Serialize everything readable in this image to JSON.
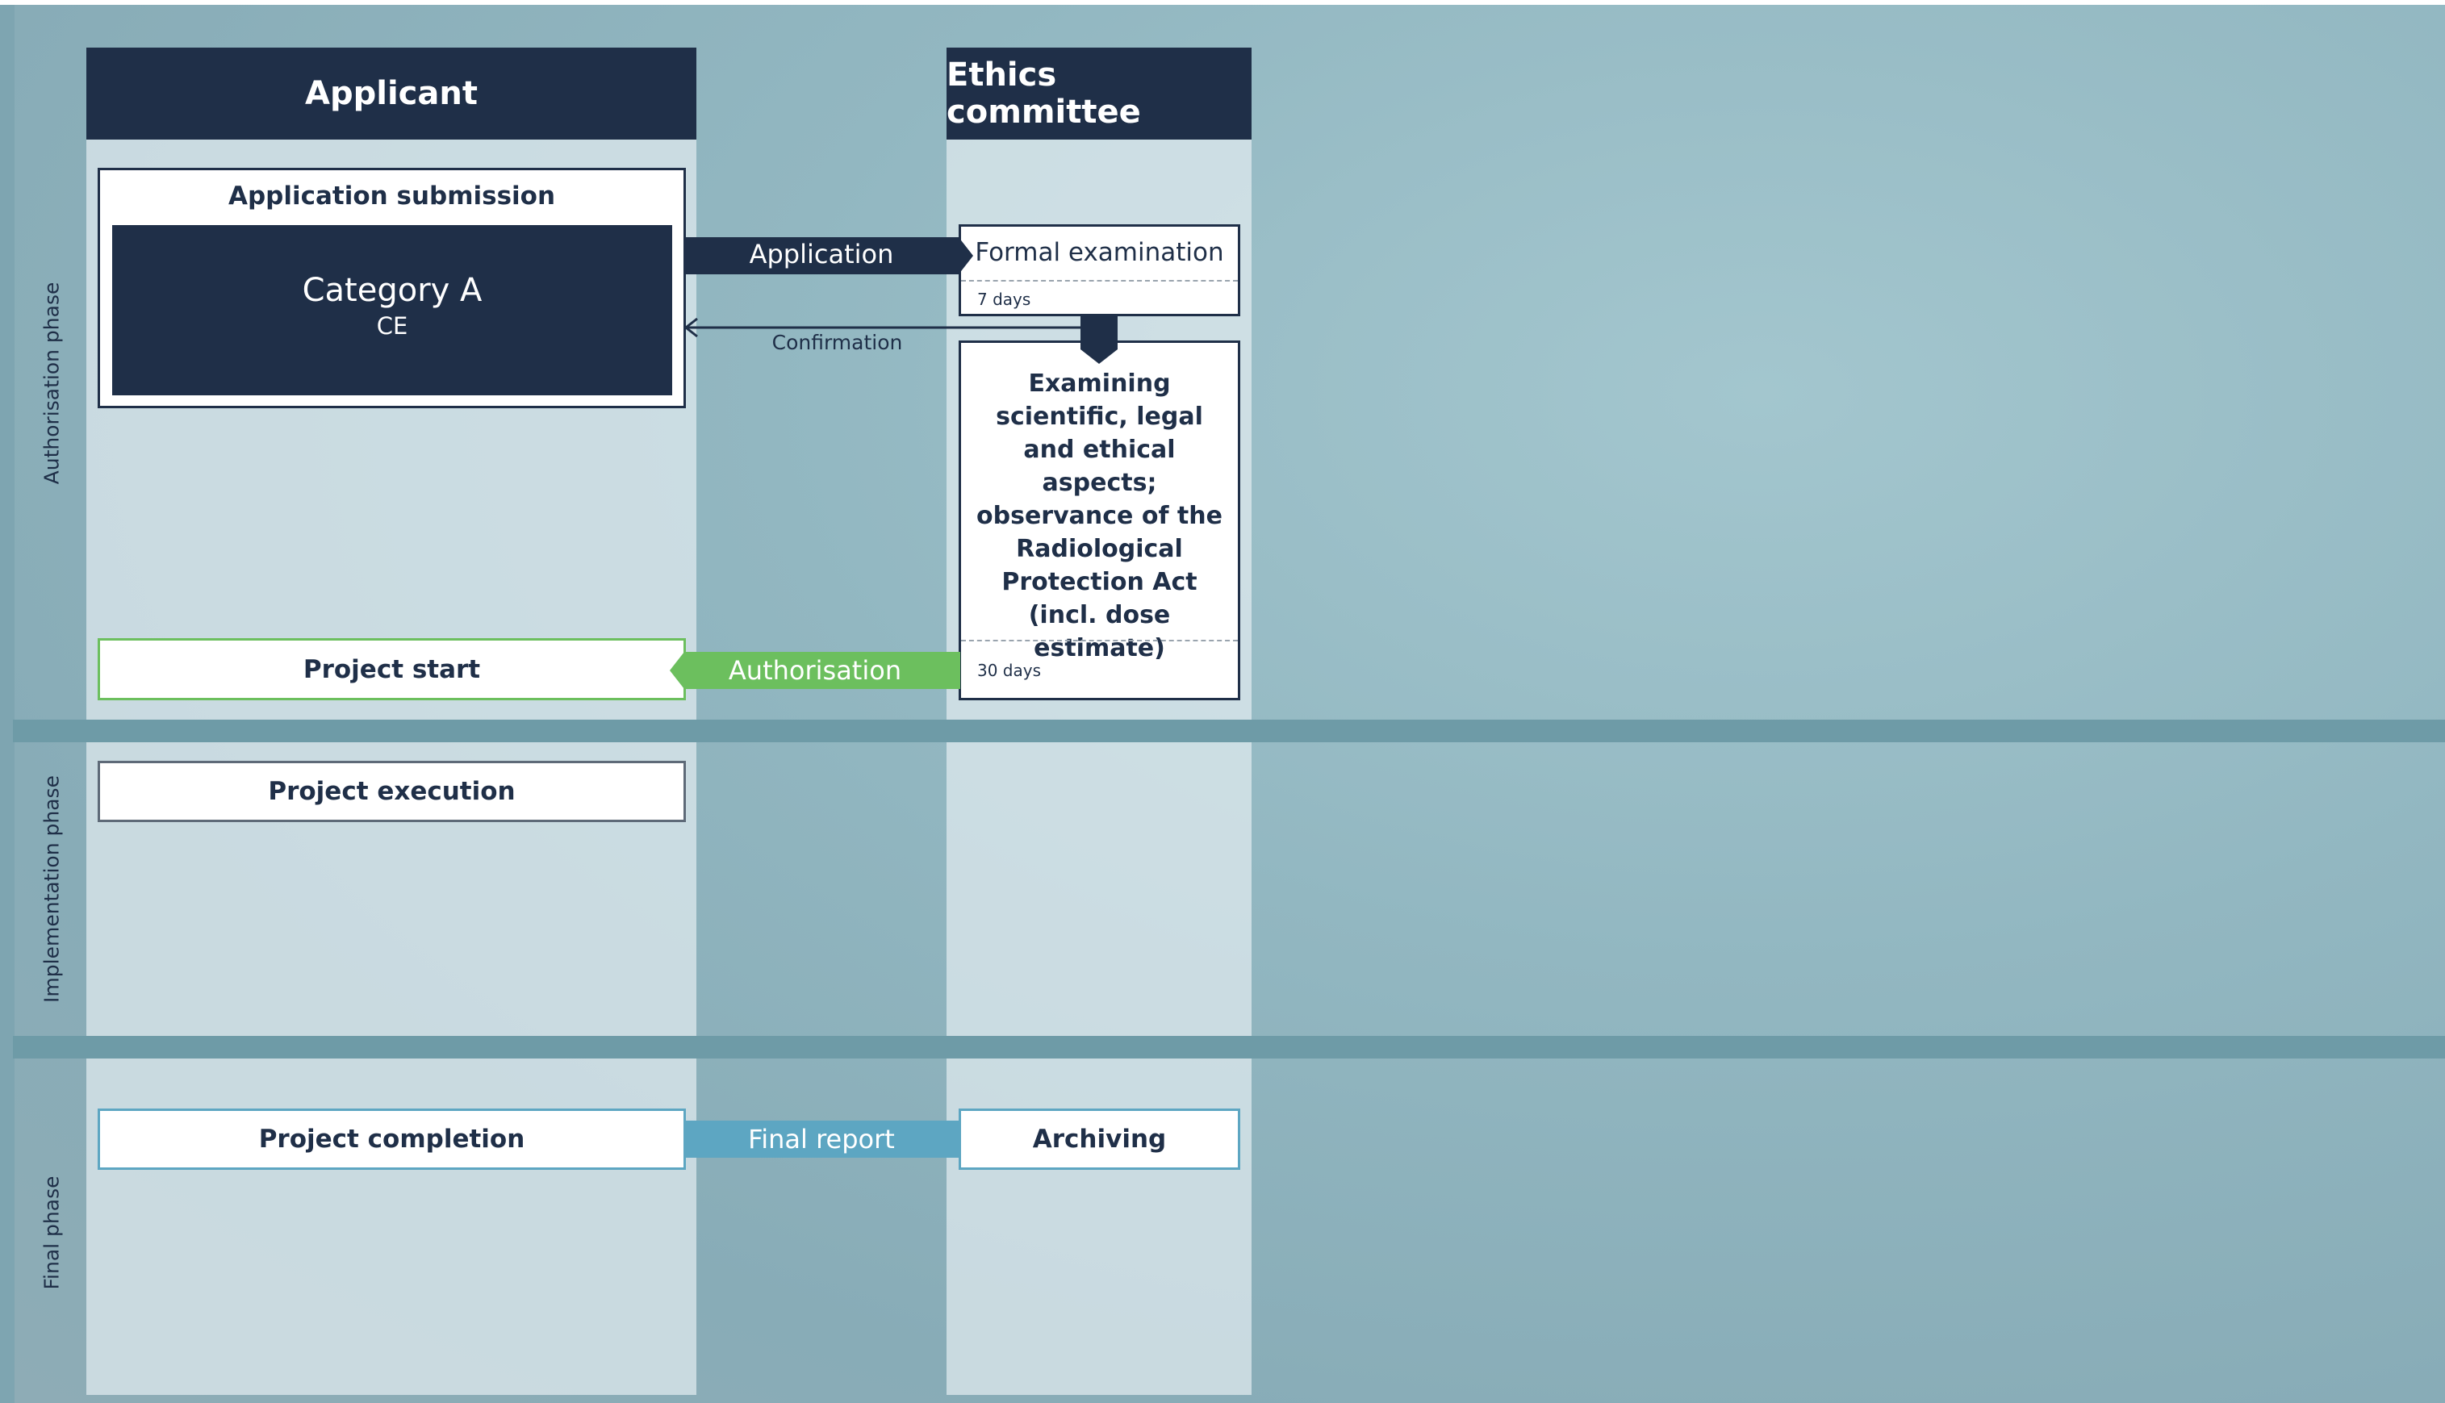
{
  "colors": {
    "navy": "#1f2f48",
    "green": "#6cbf5e",
    "blue": "#5da6c2"
  },
  "columns": {
    "applicant": "Applicant",
    "ethics": "Ethics committee"
  },
  "phases": {
    "authorisation": "Authorisation phase",
    "implementation": "Implementation phase",
    "final": "Final phase"
  },
  "submission": {
    "title": "Application submission",
    "category": "Category A",
    "sub": "CE"
  },
  "ethics_steps": {
    "formal": "Formal examination",
    "formal_days": "7 days",
    "examining": "Examining scientific, legal and ethical aspects; observance of the Radiological Protection Act (incl. dose estimate)",
    "examining_days": "30 days",
    "archiving": "Archiving"
  },
  "applicant_steps": {
    "start": "Project start",
    "execution": "Project execution",
    "completion": "Project completion"
  },
  "flows": {
    "application": "Application",
    "confirmation": "Confirmation",
    "authorisation": "Authorisation",
    "final_report": "Final report"
  }
}
